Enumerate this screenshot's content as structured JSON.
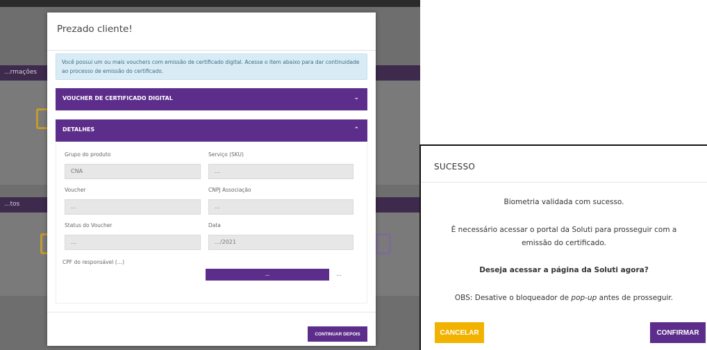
{
  "background_app": {
    "band1_label": "...rmações",
    "band2_label": "...tos"
  },
  "modal": {
    "title": "Prezado cliente!",
    "info_text": "Você possui um ou mais vouchers com emissão de certificado digital. Acesse o item abaixo para dar continuidade ao processo de emissão do certificado.",
    "accordion_voucher": "VOUCHER DE CERTIFICADO DIGITAL",
    "accordion_details": "DETALHES",
    "fields": [
      {
        "label": "Grupo do produto",
        "value": "CNA"
      },
      {
        "label": "Serviço (SKU)",
        "value": "…"
      },
      {
        "label": "Voucher",
        "value": "…"
      },
      {
        "label": "CNPJ Associação",
        "value": "…"
      },
      {
        "label": "Status do Voucher",
        "value": "…"
      },
      {
        "label": "Data",
        "value": "…/2021"
      }
    ],
    "cpf_label": "CPF do responsável (…)",
    "validate_button": "…",
    "ok_text": "…",
    "continue_later_button": "CONTINUAR DEPOIS"
  },
  "dialog": {
    "title": "SUCESSO",
    "line1": "Biometria validada com sucesso.",
    "line2": "É necessário acessar o portal da Soluti para prosseguir com a",
    "line3": "emissão do certificado.",
    "question": "Deseja acessar a página da Soluti agora?",
    "obs_prefix": "OBS: Desative o bloqueador de ",
    "obs_italic": "pop-up",
    "obs_suffix": " antes de prosseguir.",
    "cancel_button": "CANCELAR",
    "confirm_button": "CONFIRMAR"
  }
}
